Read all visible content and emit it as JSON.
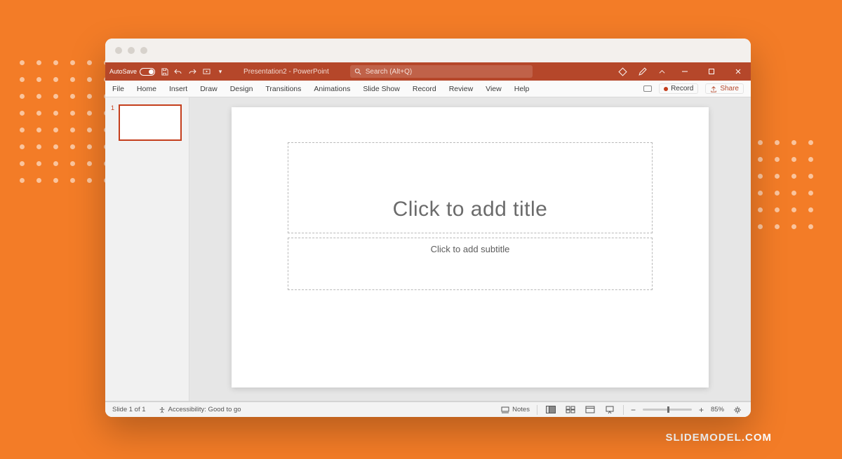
{
  "brand": "SLIDEMODEL.COM",
  "titlebar": {
    "autosave_label": "AutoSave",
    "doc_title": "Presentation2 - PowerPoint",
    "search_placeholder": "Search (Alt+Q)"
  },
  "ribbon": {
    "tabs": [
      "File",
      "Home",
      "Insert",
      "Draw",
      "Design",
      "Transitions",
      "Animations",
      "Slide Show",
      "Record",
      "Review",
      "View",
      "Help"
    ],
    "record_label": "Record",
    "share_label": "Share"
  },
  "thumbnail": {
    "number": "1"
  },
  "slide": {
    "title_placeholder": "Click to add title",
    "subtitle_placeholder": "Click to add subtitle"
  },
  "status": {
    "slide_info": "Slide 1 of 1",
    "accessibility": "Accessibility: Good to go",
    "notes_label": "Notes",
    "zoom_label": "85%"
  }
}
